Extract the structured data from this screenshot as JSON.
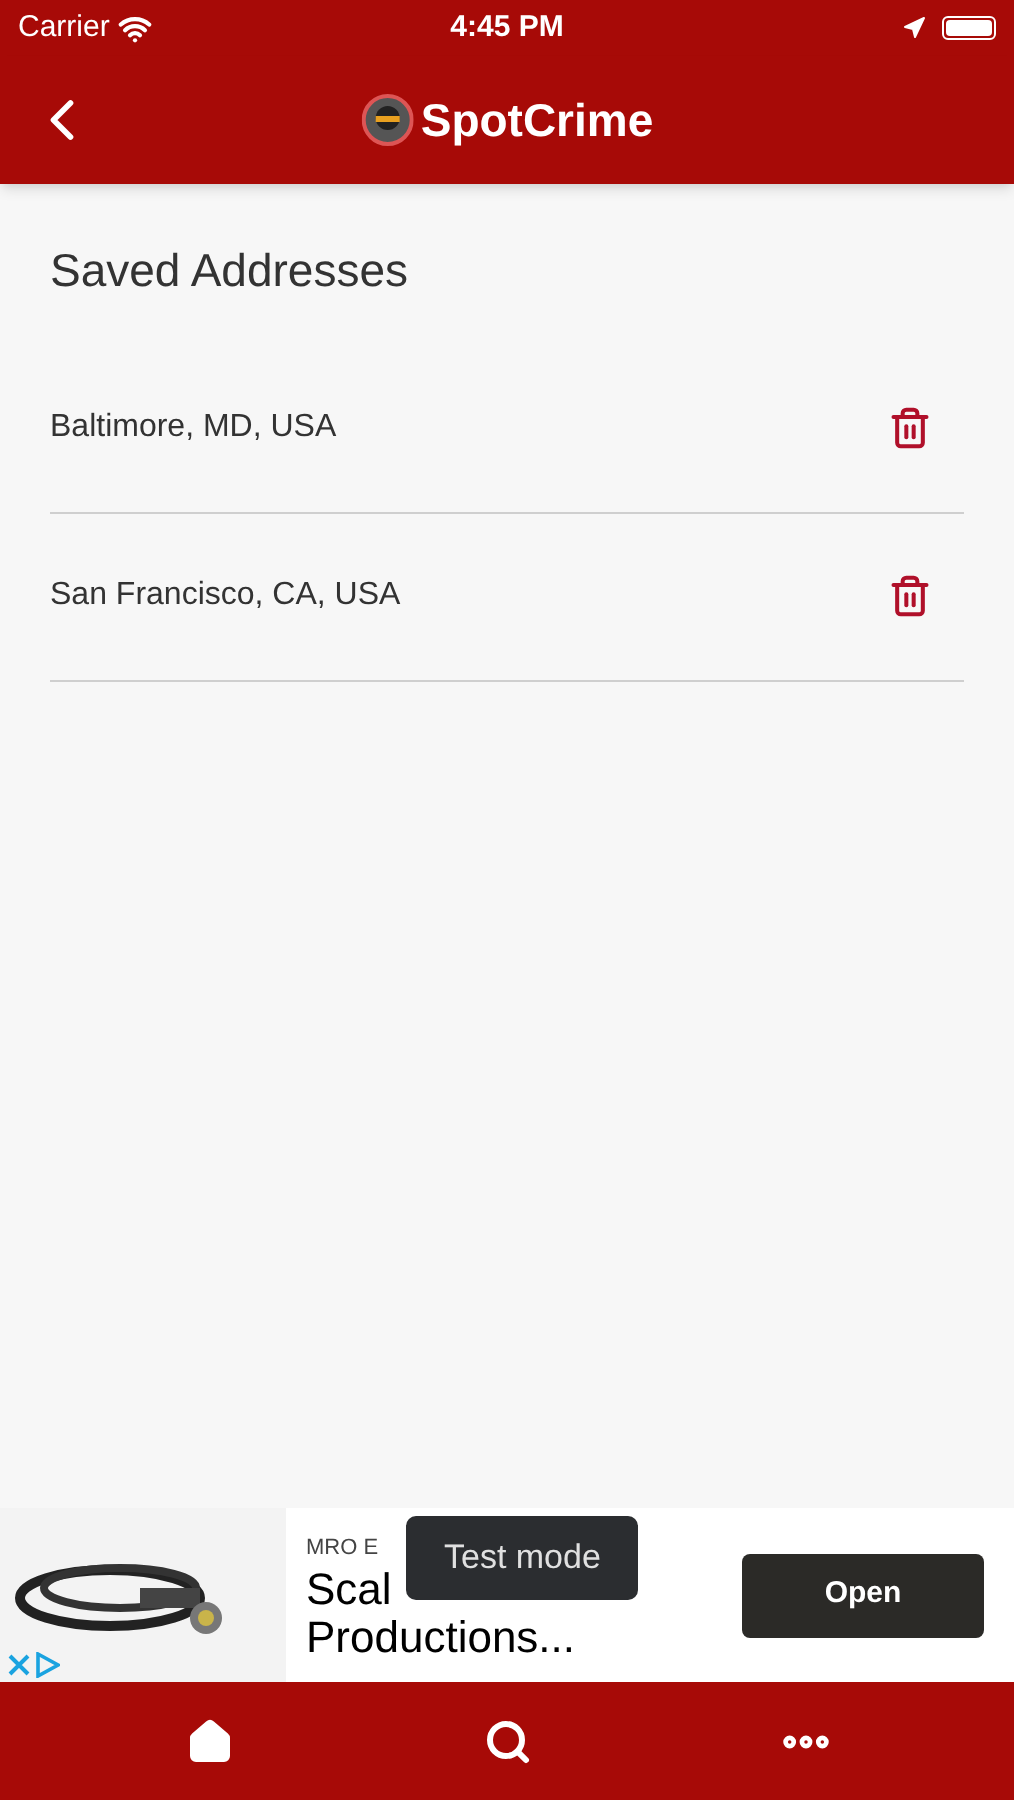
{
  "status_bar": {
    "carrier": "Carrier",
    "time": "4:45 PM"
  },
  "header": {
    "logo_text": "SpotCrime"
  },
  "page": {
    "title": "Saved Addresses"
  },
  "addresses": [
    {
      "label": "Baltimore, MD, USA"
    },
    {
      "label": "San Francisco, CA, USA"
    }
  ],
  "ad": {
    "advertiser": "MRO E",
    "headline_1": "Scal",
    "headline_2": "Productions...",
    "button": "Open",
    "tooltip": "Test mode"
  },
  "tab_bar": [
    {
      "kind": "home"
    },
    {
      "kind": "search"
    },
    {
      "kind": "more"
    }
  ]
}
